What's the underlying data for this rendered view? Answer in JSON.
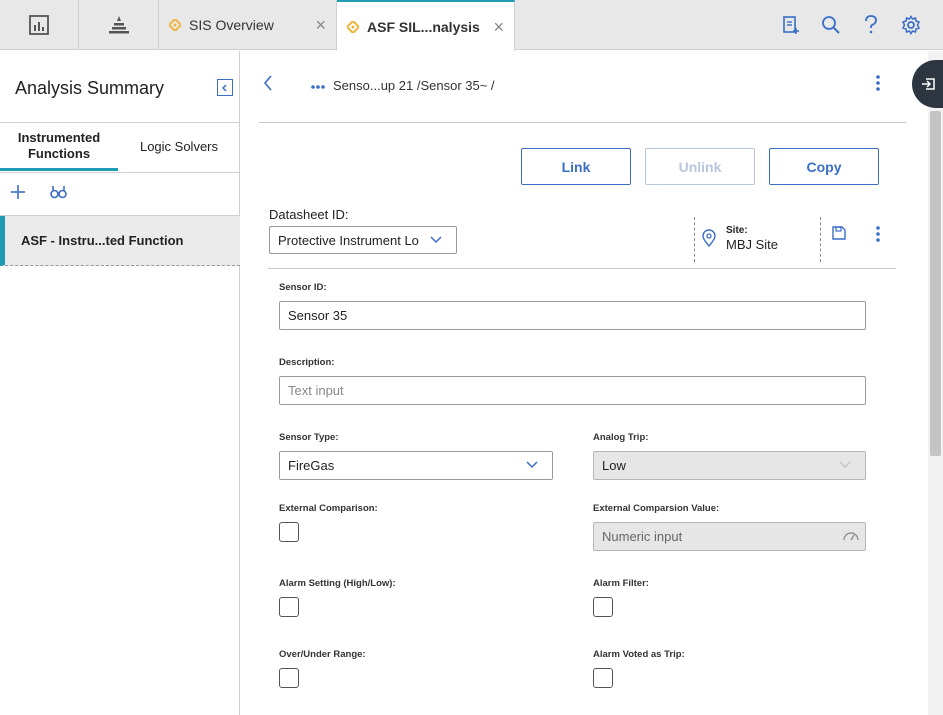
{
  "topbar": {
    "tabs": [
      {
        "label": "SIS Overview"
      },
      {
        "label": "ASF SIL...nalysis"
      }
    ],
    "close_glyph": "×"
  },
  "left": {
    "title": "Analysis Summary",
    "tabs": [
      "Instrumented Functions",
      "Logic Solvers"
    ],
    "items": [
      "ASF - Instru...ted Function"
    ]
  },
  "main": {
    "breadcrumb": "Senso...up 21 /Sensor 35~ /",
    "buttons": {
      "link": "Link",
      "unlink": "Unlink",
      "copy": "Copy"
    },
    "datasheet_label": "Datasheet ID:",
    "datasheet_value": "Protective Instrument Lo",
    "site_label": "Site:",
    "site_value": "MBJ Site"
  },
  "form": {
    "sensor_id_label": "Sensor ID:",
    "sensor_id_value": "Sensor 35",
    "description_label": "Description:",
    "description_placeholder": "Text input",
    "sensor_type_label": "Sensor Type:",
    "sensor_type_value": "FireGas",
    "analog_trip_label": "Analog Trip:",
    "analog_trip_value": "Low",
    "external_comparison_label": "External Comparison:",
    "external_comparison_value_label": "External Comparsion Value:",
    "external_comparison_value_placeholder": "Numeric input",
    "alarm_setting_label": "Alarm Setting (High/Low):",
    "alarm_filter_label": "Alarm Filter:",
    "over_under_label": "Over/Under Range:",
    "alarm_voted_label": "Alarm Voted as Trip:"
  },
  "colors": {
    "accent": "#3a6ec7",
    "teal": "#1f9bb4",
    "tab_diamond": "#f0b43c"
  }
}
